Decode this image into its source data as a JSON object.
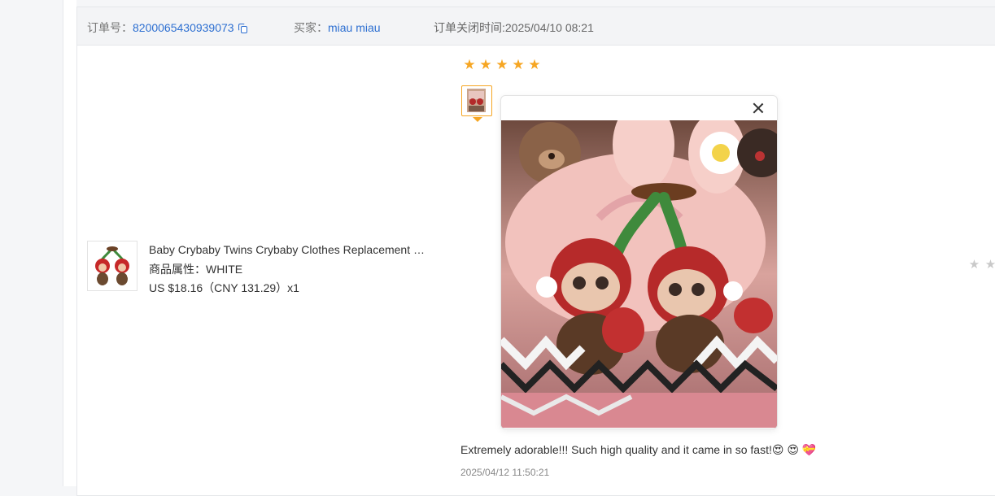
{
  "order": {
    "number_label": "订单号：",
    "number": "8200065430939073",
    "buyer_label": "买家：",
    "buyer": "miau miau",
    "closed_time": "订单关闭时间:2025/04/10 08:21"
  },
  "product": {
    "title": "Baby Crybaby Twins Crybaby Clothes Replacement Outfit",
    "attr_label": "商品属性：",
    "attr_value": "WHITE",
    "price": "US $18.16（CNY  131.29）x1"
  },
  "review": {
    "rating": 5,
    "text": "Extremely adorable!!! Such high quality and it came in so fast!😍 😍 💝",
    "date": "2025/04/12 11:50:21"
  },
  "colors": {
    "link": "#2d6fd1",
    "star": "#f6a623",
    "star_empty": "#c9c9c9"
  }
}
